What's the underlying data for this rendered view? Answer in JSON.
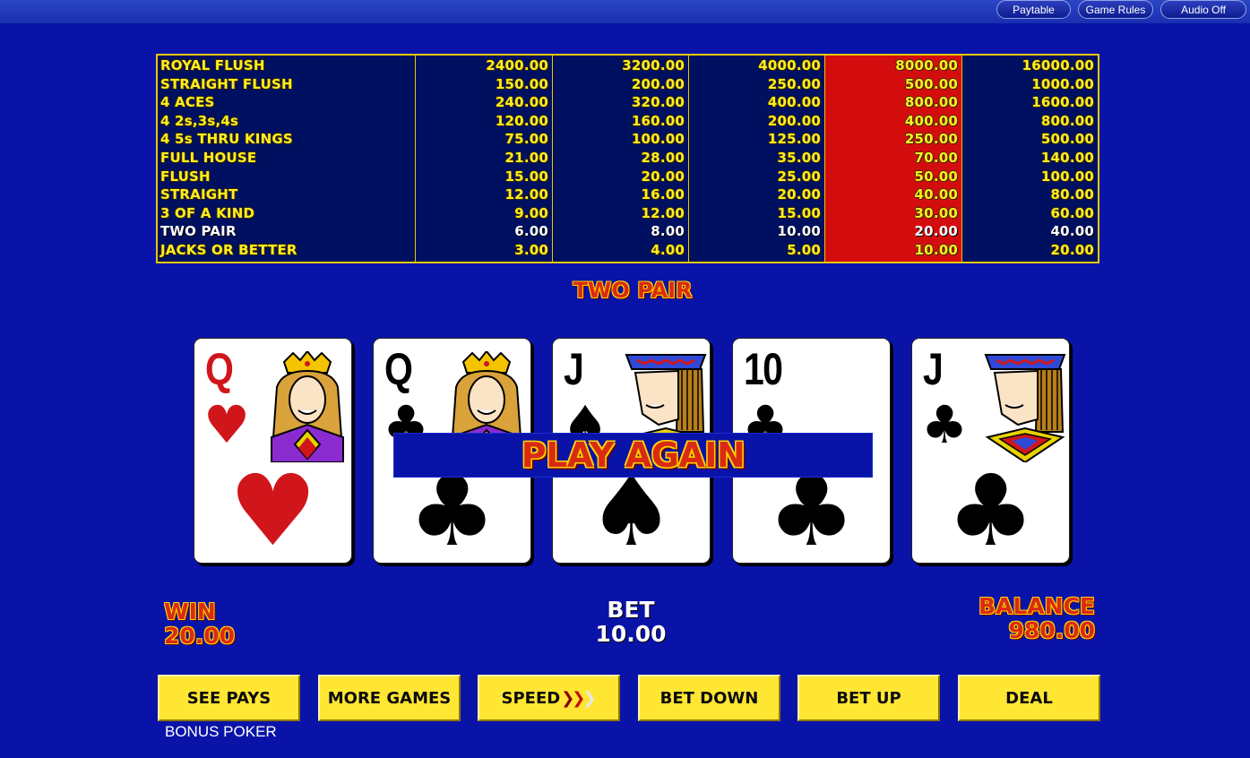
{
  "top_menu": {
    "paytable": "Paytable",
    "game_rules": "Game Rules",
    "audio": "Audio Off"
  },
  "paytable": {
    "highlight_column": 3,
    "winning_row": 9,
    "rows": [
      {
        "hand": "ROYAL FLUSH",
        "payouts": [
          "2400.00",
          "3200.00",
          "4000.00",
          "8000.00",
          "16000.00"
        ]
      },
      {
        "hand": "STRAIGHT FLUSH",
        "payouts": [
          "150.00",
          "200.00",
          "250.00",
          "500.00",
          "1000.00"
        ]
      },
      {
        "hand": "4 ACES",
        "payouts": [
          "240.00",
          "320.00",
          "400.00",
          "800.00",
          "1600.00"
        ]
      },
      {
        "hand": "4 2s,3s,4s",
        "payouts": [
          "120.00",
          "160.00",
          "200.00",
          "400.00",
          "800.00"
        ]
      },
      {
        "hand": "4 5s THRU KINGS",
        "payouts": [
          "75.00",
          "100.00",
          "125.00",
          "250.00",
          "500.00"
        ]
      },
      {
        "hand": "FULL HOUSE",
        "payouts": [
          "21.00",
          "28.00",
          "35.00",
          "70.00",
          "140.00"
        ]
      },
      {
        "hand": "FLUSH",
        "payouts": [
          "15.00",
          "20.00",
          "25.00",
          "50.00",
          "100.00"
        ]
      },
      {
        "hand": "STRAIGHT",
        "payouts": [
          "12.00",
          "16.00",
          "20.00",
          "40.00",
          "80.00"
        ]
      },
      {
        "hand": "3 OF A KIND",
        "payouts": [
          "9.00",
          "12.00",
          "15.00",
          "30.00",
          "60.00"
        ]
      },
      {
        "hand": "TWO PAIR",
        "payouts": [
          "6.00",
          "8.00",
          "10.00",
          "20.00",
          "40.00"
        ]
      },
      {
        "hand": "JACKS OR BETTER",
        "payouts": [
          "3.00",
          "4.00",
          "5.00",
          "10.00",
          "20.00"
        ]
      }
    ]
  },
  "result": "TWO PAIR",
  "cards": [
    {
      "rank": "Q",
      "suit": "hearts",
      "symbol": "♥",
      "color": "#d0161b"
    },
    {
      "rank": "Q",
      "suit": "clubs",
      "symbol": "♣",
      "color": "#000000"
    },
    {
      "rank": "J",
      "suit": "spades",
      "symbol": "♠",
      "color": "#000000"
    },
    {
      "rank": "10",
      "suit": "clubs",
      "symbol": "♣",
      "color": "#000000"
    },
    {
      "rank": "J",
      "suit": "clubs",
      "symbol": "♣",
      "color": "#000000"
    }
  ],
  "overlay": "PLAY AGAIN",
  "stats": {
    "win_label": "WIN",
    "win_value": "20.00",
    "bet_label": "BET",
    "bet_value": "10.00",
    "balance_label": "BALANCE",
    "balance_value": "980.00"
  },
  "buttons": {
    "see_pays": "SEE PAYS",
    "more_games": "MORE GAMES",
    "speed": "SPEED",
    "bet_down": "BET DOWN",
    "bet_up": "BET UP",
    "deal": "DEAL"
  },
  "game_name": "BONUS POKER",
  "colors": {
    "background": "#0a13a8",
    "highlight": "#d30d0d",
    "button": "#ffe633",
    "text_gold": "#ffee22"
  }
}
